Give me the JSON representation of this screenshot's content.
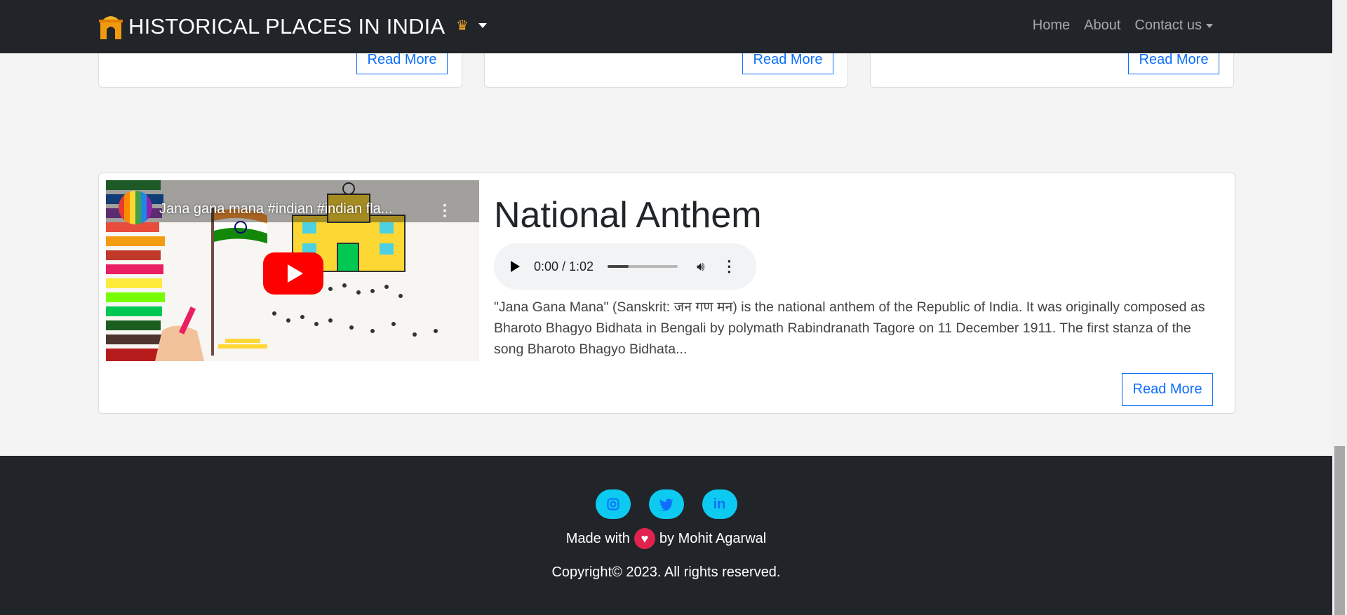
{
  "navbar": {
    "brand": "HISTORICAL PLACES IN INDIA",
    "home": "Home",
    "about": "About",
    "contact": "Contact us"
  },
  "top_cards": [
    {
      "read_more": "Read More"
    },
    {
      "read_more": "Read More"
    },
    {
      "read_more": "Read More"
    }
  ],
  "anthem": {
    "video_title": "Jana gana mana #indian #indian fla...",
    "title": "National Anthem",
    "audio_time": "0:00 / 1:02",
    "audio_progress": 0.3,
    "description": "\"Jana Gana Mana\" (Sanskrit: जन गण मन) is the national anthem of the Republic of India. It was originally composed as Bharoto Bhagyo Bidhata in Bengali by polymath Rabindranath Tagore on 11 December 1911. The first stanza of the song Bharoto Bhagyo Bidhata...",
    "read_more": "Read More"
  },
  "footer": {
    "made_with": "Made with",
    "by": "by Mohit Agarwal",
    "copyright": "Copyright© 2023. All rights reserved."
  },
  "colors": {
    "navbar_bg": "#212529",
    "accent": "#0d6efd",
    "social_bg": "#0dcaf0"
  }
}
